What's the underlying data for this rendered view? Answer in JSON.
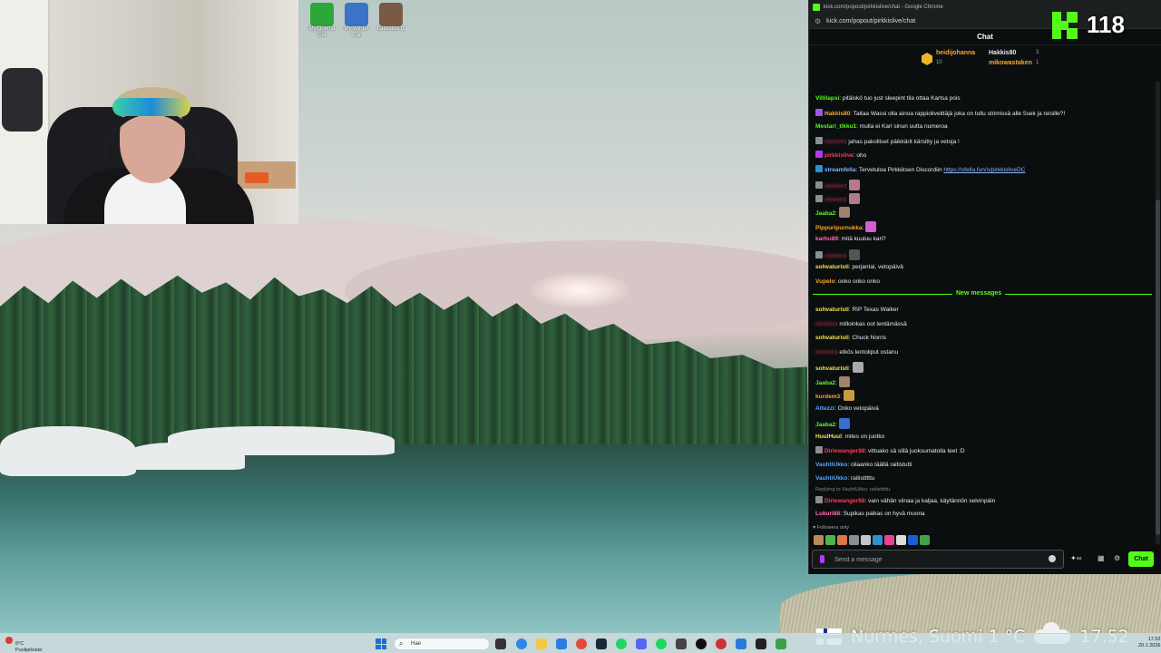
{
  "desktop": {
    "icons": [
      {
        "label": "MyCinema Car",
        "color": "#2da63a"
      },
      {
        "label": "My Winter Car",
        "color": "#3b74c7"
      },
      {
        "label": "Lakeside Iz",
        "color": "#7b5a45"
      }
    ]
  },
  "browser": {
    "window_title": "kick.com/popout/pirkkislive/chat - Google Chrome",
    "url": "kick.com/popout/pirkkislive/chat"
  },
  "chat": {
    "header": "Chat",
    "leaderboard": {
      "top": {
        "name": "heidijohanna",
        "count": "10"
      },
      "second": {
        "name": "Hakkis80",
        "count": "3"
      },
      "third": {
        "name": "mikowastaken",
        "count": "1"
      }
    },
    "messages": [
      {
        "user": "Villilapsi",
        "color": "#53fc18",
        "text": ": pitäiskö tuo just sleepint tila ottaa Kartsa pois"
      },
      {
        "user": "Hakkis80",
        "color": "#f7a82a",
        "text": ": Taitaa Wassi olla ainoa rappioliveittäjä joka on tullu strimissä alle 5sek ja reisille?!"
      },
      {
        "user": "Mestari_tikku1",
        "color": "#53fc18",
        "text": ": mulla ei Karl sinun uutta numeroa"
      },
      {
        "user": "",
        "color": "#ff3b5c",
        "text": ": jahas pakolliset päikkärit kärsitty ja vetoja !"
      },
      {
        "user": "pirkkislive",
        "color": "#ff3b5c",
        "text": ": oho"
      },
      {
        "user": "streamfella",
        "color": "#7fb6ff",
        "text": ": Tervetuloa Pirkkiksen Discordiin ",
        "link": "https://sfella.fun/s/pirkkisliveDC"
      },
      {
        "user": "",
        "color": "#ff3b5c",
        "text": ":"
      },
      {
        "user": "",
        "color": "#ff3b5c",
        "text": ":"
      },
      {
        "user": "Jaaba2",
        "color": "#53fc18",
        "text": ":"
      },
      {
        "user": "Pippuripurnukka",
        "color": "#f7a82a",
        "text": ":"
      },
      {
        "user": "karhu89",
        "color": "#ff6fb5",
        "text": ": mitä kuuluu kari?"
      },
      {
        "user": "",
        "color": "#ff3b5c",
        "text": ":"
      },
      {
        "user": "sohvaturisti",
        "color": "#f2e64c",
        "text": ": perjantai, vetopäivä"
      },
      {
        "user": "Vupelo",
        "color": "#f7a82a",
        "text": ": onko onko onko"
      },
      {
        "user": "sohvaturisti",
        "color": "#f2e64c",
        "text": ": RIP Texas Walker"
      },
      {
        "user": "",
        "color": "#ff3b5c",
        "text": ": milloinkas oot lentämässä"
      },
      {
        "user": "sohvaturisti",
        "color": "#f2e64c",
        "text": ": Chuck Norris"
      },
      {
        "user": "",
        "color": "#ff3b5c",
        "text": ": etkös lentoliput ostanu"
      },
      {
        "user": "sohvaturisti",
        "color": "#f2e64c",
        "text": ":"
      },
      {
        "user": "Jaaba2",
        "color": "#53fc18",
        "text": ":"
      },
      {
        "user": "kurdem3",
        "color": "#f7a82a",
        "text": ":"
      },
      {
        "user": "Attezzi",
        "color": "#53a6ff",
        "text": ": Onko vetopäivä"
      },
      {
        "user": "Jaaba2",
        "color": "#53fc18",
        "text": ":"
      },
      {
        "user": "HuulHuul",
        "color": "#f2e64c",
        "text": ": mites on juotko"
      },
      {
        "user": "Dirlewanger88",
        "color": "#ff3b5c",
        "text": ": vittuako sä sillä juoksumatolla teet :D"
      },
      {
        "user": "VauhtiUkko",
        "color": "#53a6ff",
        "text": ": oliaanko täällä raitistutti"
      },
      {
        "user": "VauhtiUkko",
        "color": "#53a6ff",
        "text": ": raitistttttu"
      },
      {
        "user": "Dirlewanger88",
        "color": "#ff3b5c",
        "text": ": vain vähän viinaa ja kaljaa, käytännön selvinpäin"
      },
      {
        "user": "Lukuri88",
        "color": "#ff6fb5",
        "text": ": Supikas paikas on hyvä muona"
      }
    ],
    "new_messages_label": "New messages",
    "reply_context": "Replying to VauhtiUkko: raitistttttu",
    "followers_only": "Followers only",
    "input_placeholder": "Send a message",
    "send_label": "Chat"
  },
  "overlay": {
    "viewer_count": "118",
    "weather": "Nurmes, Suomi  1 °C",
    "time": "17.52"
  },
  "taskbar": {
    "weather_temp": "6°C",
    "weather_desc": "Puolipilvistä",
    "search_placeholder": "Hae",
    "clock_time": "17.52",
    "clock_date": "20.1.2026"
  },
  "colors": {
    "kick_green": "#53fc18"
  }
}
